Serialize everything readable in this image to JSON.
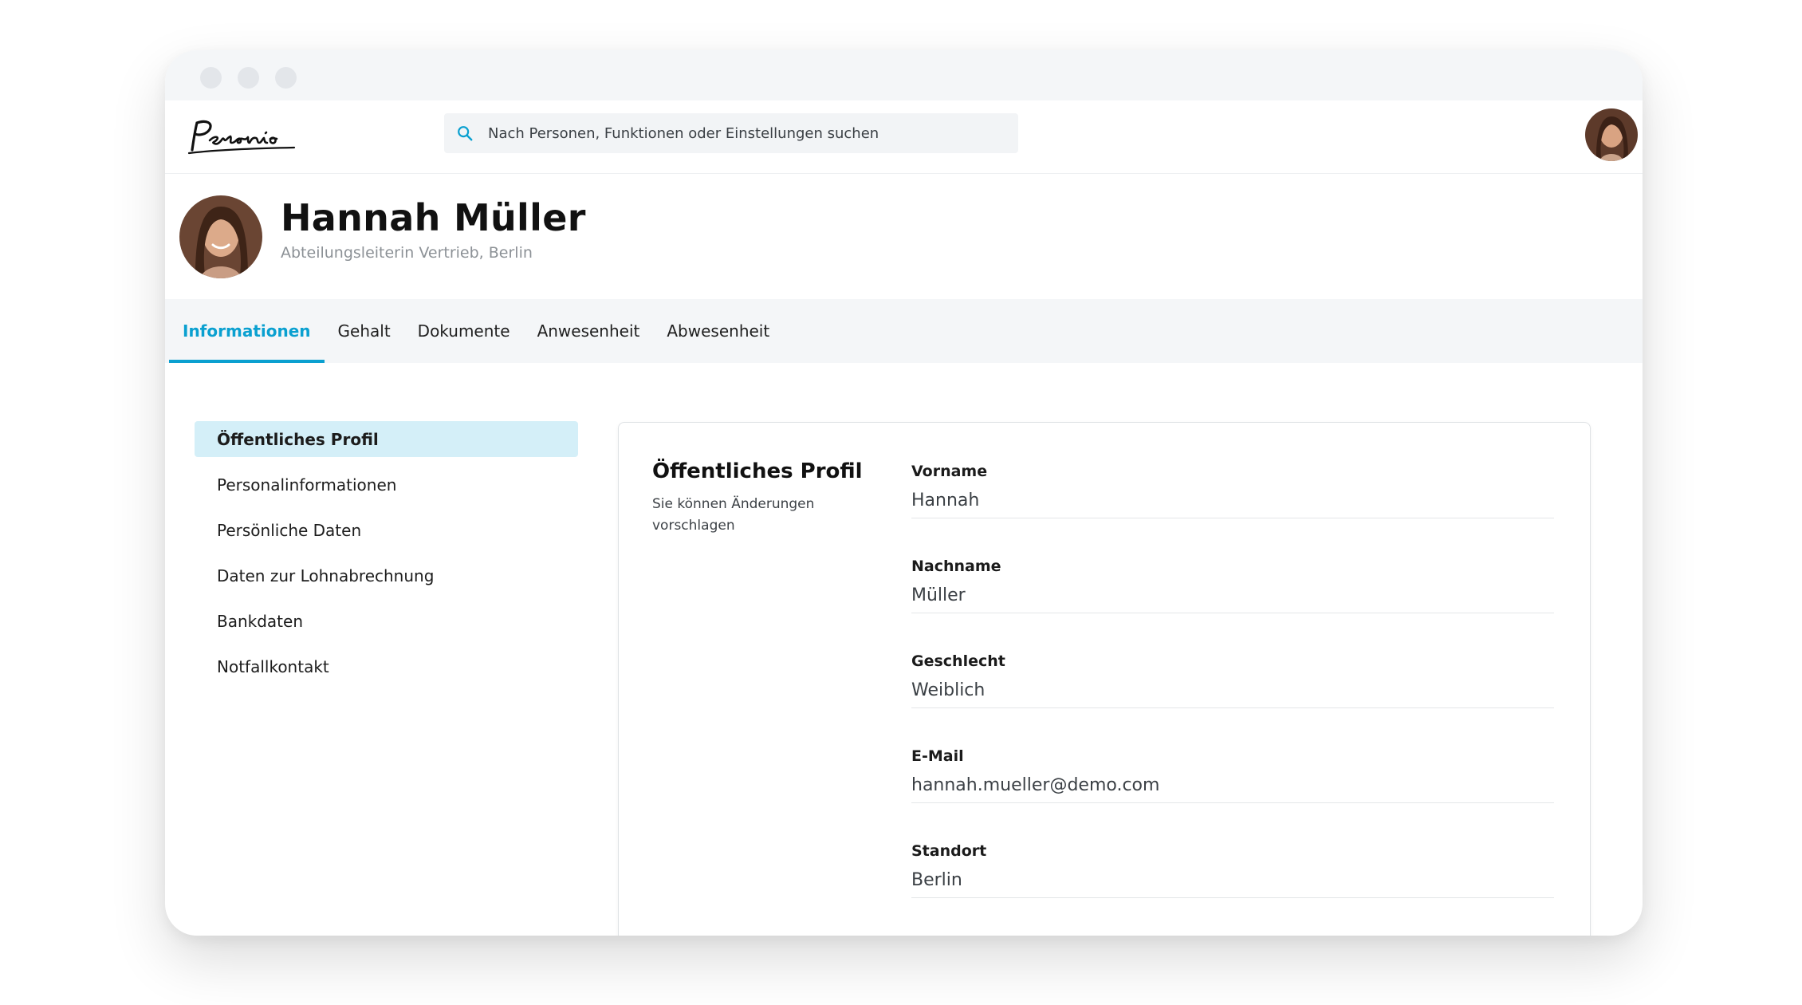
{
  "colors": {
    "accent": "#0aa0d0",
    "active_bg": "#d4eff8",
    "titlebar": "#f4f6f8"
  },
  "header": {
    "logo_text": "Personio",
    "search": {
      "placeholder": "Nach Personen, Funktionen oder Einstellungen suchen",
      "icon": "search-icon"
    },
    "avatar": "user-avatar"
  },
  "profile": {
    "name": "Hannah Müller",
    "role": "Abteilungsleiterin Vertrieb, Berlin"
  },
  "tabs": [
    {
      "label": "Informationen",
      "active": true
    },
    {
      "label": "Gehalt"
    },
    {
      "label": "Dokumente"
    },
    {
      "label": "Anwesenheit"
    },
    {
      "label": "Abwesenheit"
    }
  ],
  "sidebar": {
    "items": [
      {
        "label": "Öffentliches Profil",
        "active": true
      },
      {
        "label": "Personalinformationen"
      },
      {
        "label": "Persönliche Daten"
      },
      {
        "label": "Daten zur Lohnabrechnung"
      },
      {
        "label": "Bankdaten"
      },
      {
        "label": "Notfallkontakt"
      }
    ]
  },
  "card": {
    "title": "Öffentliches Profil",
    "subtitle": "Sie können Änderungen vorschlagen",
    "fields": [
      {
        "label": "Vorname",
        "value": "Hannah"
      },
      {
        "label": "Nachname",
        "value": "Müller"
      },
      {
        "label": "Geschlecht",
        "value": "Weiblich"
      },
      {
        "label": "E-Mail",
        "value": "hannah.mueller@demo.com"
      },
      {
        "label": "Standort",
        "value": "Berlin"
      }
    ]
  }
}
